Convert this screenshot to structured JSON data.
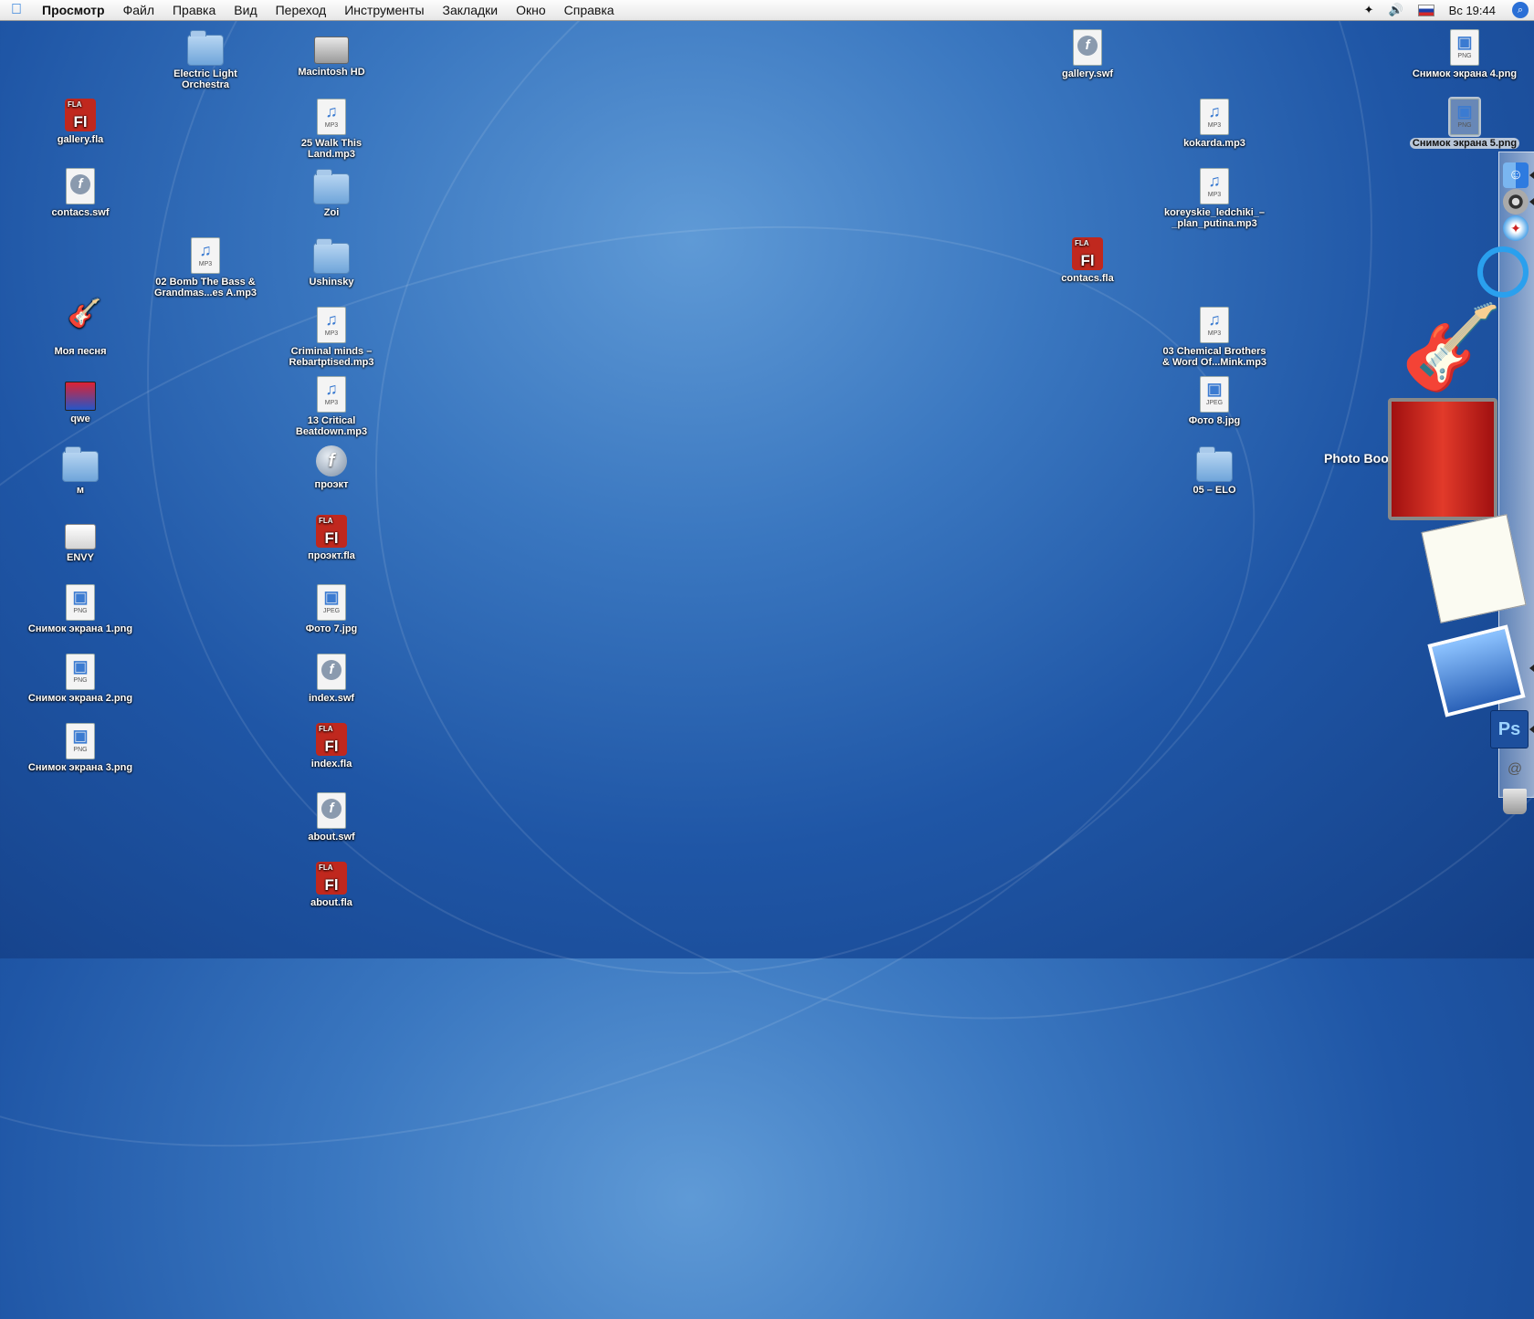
{
  "menubar": {
    "app": "Просмотр",
    "items": [
      "Файл",
      "Правка",
      "Вид",
      "Переход",
      "Инструменты",
      "Закладки",
      "Окно",
      "Справка"
    ],
    "clock": "Вс 19:44"
  },
  "desktop": {
    "col1": [
      {
        "label": "gallery.fla",
        "type": "fla"
      },
      {
        "label": "contacs.swf",
        "type": "swf"
      },
      {
        "label": "Моя песня",
        "type": "guitar"
      },
      {
        "label": "qwe",
        "type": "movie"
      },
      {
        "label": "м",
        "type": "folder"
      },
      {
        "label": "ENVY",
        "type": "disk"
      },
      {
        "label": "Снимок экрана 1.png",
        "type": "png"
      },
      {
        "label": "Снимок экрана 2.png",
        "type": "png"
      },
      {
        "label": "Снимок экрана 3.png",
        "type": "png"
      }
    ],
    "col2": [
      {
        "label": "Electric Light Orchestra",
        "type": "folder"
      },
      {
        "label": "02 Bomb The Bass & Grandmas...es A.mp3",
        "type": "mp3"
      }
    ],
    "col3": [
      {
        "label": "Macintosh HD",
        "type": "hd"
      },
      {
        "label": "25 Walk This Land.mp3",
        "type": "mp3"
      },
      {
        "label": "Zoi",
        "type": "folder"
      },
      {
        "label": "Ushinsky",
        "type": "folder"
      },
      {
        "label": "Criminal minds – Rebartptised.mp3",
        "type": "mp3"
      },
      {
        "label": "13 Critical Beatdown.mp3",
        "type": "mp3"
      },
      {
        "label": "проэкт",
        "type": "swfround"
      },
      {
        "label": "проэкт.fla",
        "type": "fla"
      },
      {
        "label": "Фото 7.jpg",
        "type": "jpeg"
      },
      {
        "label": "index.swf",
        "type": "swf"
      },
      {
        "label": "index.fla",
        "type": "fla"
      },
      {
        "label": "about.swf",
        "type": "swf"
      },
      {
        "label": "about.fla",
        "type": "fla"
      }
    ],
    "col4": [
      {
        "label": "gallery.swf",
        "type": "swf"
      },
      {
        "label": "contacs.fla",
        "type": "fla"
      }
    ],
    "col5": [
      {
        "label": "kokarda.mp3",
        "type": "mp3"
      },
      {
        "label": "koreyskie_ledchiki_–_plan_putina.mp3",
        "type": "mp3"
      },
      {
        "label": "03 Chemical Brothers & Word Of...Mink.mp3",
        "type": "mp3"
      },
      {
        "label": "Фото 8.jpg",
        "type": "jpeg"
      },
      {
        "label": "05 – ELO",
        "type": "folder"
      }
    ],
    "col6": [
      {
        "label": "Снимок экрана 4.png",
        "type": "png"
      },
      {
        "label": "Снимок экрана 5.png",
        "type": "png"
      }
    ]
  },
  "filetype_badges": {
    "mp3": "MP3",
    "png": "PNG",
    "jpeg": "JPEG",
    "fla": "FLA",
    "fla_glyph": "Fl",
    "swf_glyph": "f"
  },
  "dock": {
    "hover_label": "Photo Booth",
    "ps_label": "Ps",
    "mail_glyph": "@"
  }
}
